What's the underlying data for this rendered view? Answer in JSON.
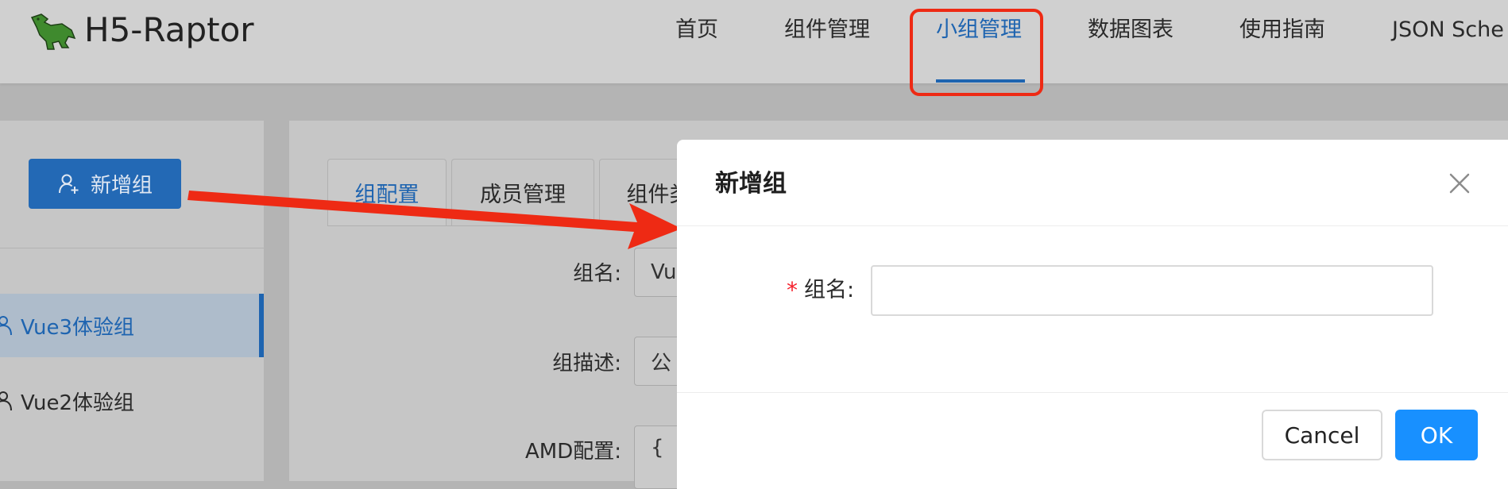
{
  "header": {
    "app_name": "H5-Raptor",
    "nav": [
      "首页",
      "组件管理",
      "小组管理",
      "数据图表",
      "使用指南",
      "JSON Sche"
    ],
    "active_index": 2
  },
  "sidebar": {
    "new_group_label": "新增组",
    "groups": [
      "Vue3体验组",
      "Vue2体验组"
    ],
    "active_index": 0
  },
  "main": {
    "tabs": [
      "组配置",
      "成员管理",
      "组件类"
    ],
    "form": {
      "name_label": "组名:",
      "name_value": "Vu",
      "desc_label": "组描述:",
      "desc_value": "公",
      "amd_label": "AMD配置:",
      "amd_value": "{"
    }
  },
  "modal": {
    "title": "新增组",
    "required_mark": "*",
    "name_label": "组名:",
    "name_value": "",
    "cancel_label": "Cancel",
    "ok_label": "OK"
  },
  "colors": {
    "accent": "#1e64b0",
    "primary_button": "#1890ff",
    "annotation": "#ee2a14",
    "required": "#f5222d"
  },
  "icons": {
    "logo": "dinosaur-logo-icon",
    "add_group": "user-add-icon",
    "group": "user-icon",
    "close": "close-icon"
  }
}
